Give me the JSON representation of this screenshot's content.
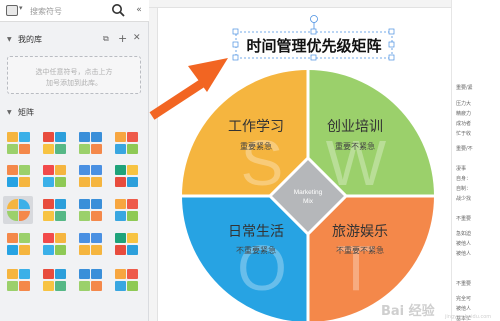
{
  "search": {
    "placeholder": "搜索符号",
    "shape_icon": "shape-picker-icon",
    "search_icon": "magnifier-icon",
    "collapse_icon": "double-chevron-left-icon"
  },
  "library": {
    "title": "我的库",
    "export_icon": "export-icon",
    "add_icon": "plus-icon",
    "close_icon": "close-icon",
    "drop_line1": "选中任意符号，点击上方",
    "drop_line2": "加号添加到此库。"
  },
  "matrix": {
    "title": "矩阵"
  },
  "diagram": {
    "title": "时间管理优先级矩阵",
    "center_line1": "Marketing",
    "center_line2": "Mix",
    "quadrants": [
      {
        "title": "工作学习",
        "subtitle": "重要紧急",
        "letter": "S",
        "color": "#f5b53f"
      },
      {
        "title": "创业培训",
        "subtitle": "重要不紧急",
        "letter": "W",
        "color": "#9bd06b"
      },
      {
        "title": "日常生活",
        "subtitle": "不重要紧急",
        "letter": "O",
        "color": "#27a3e3"
      },
      {
        "title": "旅游娱乐",
        "subtitle": "不重要不紧急",
        "letter": "T",
        "color": "#f4884a"
      }
    ],
    "arrow_color": "#f26522"
  },
  "right_doc": {
    "items": [
      "重要/紧",
      "压力大",
      "精疲力",
      "成功者",
      "忙于收",
      "重要/不",
      "凄事",
      "自身：",
      "自制：",
      "战少找",
      "不重要",
      "急如迫",
      "被他人",
      "被他人",
      "不重要",
      "完全可",
      "被他人",
      "基本忙"
    ]
  },
  "watermark": {
    "text": "Bai 经验",
    "sub": "jingyan.baidu.com"
  }
}
